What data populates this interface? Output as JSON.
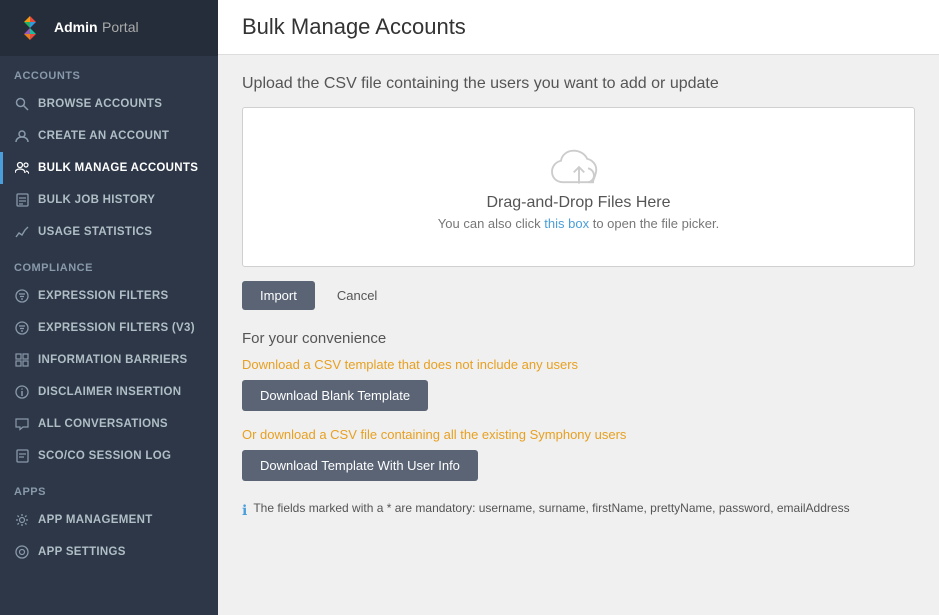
{
  "brand": {
    "admin_label": "Admin",
    "portal_label": "Portal"
  },
  "sidebar": {
    "accounts_section": "Accounts",
    "items": [
      {
        "id": "browse-accounts",
        "label": "Browse Accounts",
        "icon": "search",
        "active": false
      },
      {
        "id": "create-account",
        "label": "Create an Account",
        "icon": "user",
        "active": false
      },
      {
        "id": "bulk-manage-accounts",
        "label": "Bulk Manage Accounts",
        "icon": "users",
        "active": true
      },
      {
        "id": "bulk-job-history",
        "label": "Bulk Job History",
        "icon": "file",
        "active": false
      },
      {
        "id": "usage-statistics",
        "label": "Usage Statistics",
        "icon": "chart",
        "active": false
      }
    ],
    "compliance_section": "Compliance",
    "compliance_items": [
      {
        "id": "expression-filters",
        "label": "Expression Filters",
        "icon": "filter"
      },
      {
        "id": "expression-filters-v3",
        "label": "Expression Filters (V3)",
        "icon": "filter"
      },
      {
        "id": "information-barriers",
        "label": "Information Barriers",
        "icon": "grid"
      },
      {
        "id": "disclaimer-insertion",
        "label": "Disclaimer Insertion",
        "icon": "info"
      },
      {
        "id": "all-conversations",
        "label": "All Conversations",
        "icon": "chat"
      },
      {
        "id": "sco-co-session-log",
        "label": "SCO/CO Session Log",
        "icon": "doc"
      }
    ],
    "apps_section": "Apps",
    "apps_items": [
      {
        "id": "app-management",
        "label": "App Management",
        "icon": "gear"
      },
      {
        "id": "app-settings",
        "label": "App Settings",
        "icon": "settings"
      }
    ]
  },
  "page": {
    "title": "Bulk Manage Accounts",
    "upload_label": "Upload the CSV file containing the users you want to add or update",
    "drag_drop_text": "Drag-and-Drop Files Here",
    "click_text": "You can also click ",
    "click_link": "this box",
    "click_text_after": " to open the file picker.",
    "import_button": "Import",
    "cancel_button": "Cancel",
    "convenience_title": "For your convenience",
    "download_blank_desc": "Download a CSV template that does not include any users",
    "download_blank_btn": "Download Blank Template",
    "download_users_desc": "Or download a CSV file containing all the existing Symphony users",
    "download_users_btn": "Download Template With User Info",
    "mandatory_note": "The fields marked with a * are mandatory: username, surname, firstName, prettyName, password, emailAddress"
  }
}
